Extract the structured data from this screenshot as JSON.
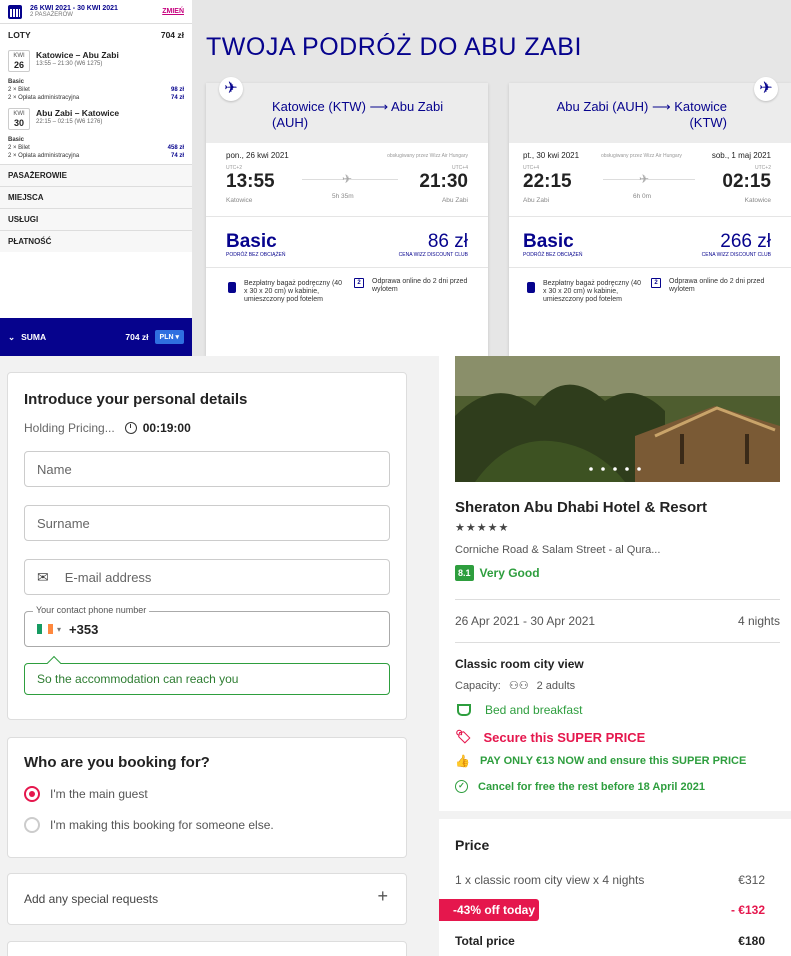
{
  "wizz": {
    "dates": "26 KWI 2021 - 30 KWI 2021",
    "passengers": "2 PASAŻERÓW",
    "change": "ZMIEŃ",
    "loty_label": "LOTY",
    "loty_total": "704 zł",
    "legs": [
      {
        "code": "KWI",
        "day": "26",
        "route": "Katowice – Abu Zabi",
        "time": "13:55 – 21:30 (W6 1275)",
        "fare": "Basic",
        "ticket_label": "2 × Bilet",
        "ticket_amt": "98 zł",
        "fee_label": "2 × Opłata administracyjna",
        "fee_amt": "74 zł"
      },
      {
        "code": "KWI",
        "day": "30",
        "route": "Abu Zabi – Katowice",
        "time": "22:15 – 02:15 (W6 1276)",
        "fare": "Basic",
        "ticket_label": "2 × Bilet",
        "ticket_amt": "458 zł",
        "fee_label": "2 × Opłata administracyjna",
        "fee_amt": "74 zł"
      }
    ],
    "sections": [
      "PASAŻEROWIE",
      "MIEJSCA",
      "USŁUGI",
      "PŁATNOŚĆ"
    ],
    "suma_label": "SUMA",
    "suma_amount": "704 zł",
    "currency": "PLN",
    "title": "TWOJA PODRÓŻ DO ABU ZABI",
    "cards": [
      {
        "title": "Katowice (KTW) ⟶ Abu Zabi (AUH)",
        "dep_date": "pon., 26 kwi 2021",
        "operator": "obsługiwany przez Wizz Air Hungary",
        "arr_date": "",
        "dep_utc": "UTC+2",
        "arr_utc": "UTC+4",
        "dep_time": "13:55",
        "arr_time": "21:30",
        "duration": "5h 35m",
        "dep_city": "Katowice",
        "arr_city": "Abu Zabi",
        "fare": "Basic",
        "fare_sub": "PODRÓŻ BEZ OBCIĄŻEŃ",
        "price": "86 zł",
        "price_sub": "CENA WIZZ DISCOUNT CLUB",
        "bag": "Bezpłatny bagaż podręczny (40 x 30 x 20 cm) w kabinie, umieszczony pod fotelem",
        "checkin": "Odprawa online do 2 dni przed wylotem"
      },
      {
        "title": "Abu Zabi (AUH) ⟶ Katowice (KTW)",
        "dep_date": "pt., 30 kwi 2021",
        "operator": "obsługiwany przez Wizz Air Hungary",
        "arr_date": "sob., 1 maj 2021",
        "dep_utc": "UTC+4",
        "arr_utc": "UTC+2",
        "dep_time": "22:15",
        "arr_time": "02:15",
        "duration": "6h 0m",
        "dep_city": "Abu Zabi",
        "arr_city": "Katowice",
        "fare": "Basic",
        "fare_sub": "PODRÓŻ BEZ OBCIĄŻEŃ",
        "price": "266 zł",
        "price_sub": "CENA WIZZ DISCOUNT CLUB",
        "bag": "Bezpłatny bagaż podręczny (40 x 30 x 20 cm) w kabinie, umieszczony pod fotelem",
        "checkin": "Odprawa online do 2 dni przed wylotem"
      }
    ],
    "colors": {
      "brand": "#06038d",
      "accent": "#c6007e"
    }
  },
  "form": {
    "title": "Introduce your personal details",
    "holding_label": "Holding Pricing...",
    "timer": "00:19:00",
    "name_placeholder": "Name",
    "surname_placeholder": "Surname",
    "email_placeholder": "E-mail address",
    "phone_label": "Your contact phone number",
    "phone_code": "+353",
    "tooltip": "So the accommodation can reach you",
    "booking_title": "Who are you booking for?",
    "opt_main": "I'm the main guest",
    "opt_other": "I'm making this booking for someone else.",
    "special": "Add any special requests",
    "special_icon": "+"
  },
  "hotel": {
    "name": "Sheraton Abu Dhabi Hotel & Resort",
    "stars": "★★★★★",
    "address": "Corniche Road & Salam Street - al Qura...",
    "rating": "8.1",
    "rating_text": "Very Good",
    "dates": "26 Apr 2021 - 30 Apr 2021",
    "nights": "4 nights",
    "room": "Classic room city view",
    "capacity_label": "Capacity:",
    "capacity": "2 adults",
    "board": "Bed and breakfast",
    "secure": "Secure this SUPER PRICE",
    "pay_only": "PAY ONLY €13 NOW and ensure this SUPER PRICE",
    "cancel": "Cancel for free the rest before 18 April 2021",
    "price_title": "Price",
    "line_label": "1 x classic room city view x 4 nights",
    "line_amt": "€312",
    "discount_label": "-43% off today",
    "discount_amt": "- €132",
    "total_label": "Total price",
    "total_amt": "€180",
    "colors": {
      "green": "#2e9e3e",
      "red": "#e5174d"
    }
  }
}
